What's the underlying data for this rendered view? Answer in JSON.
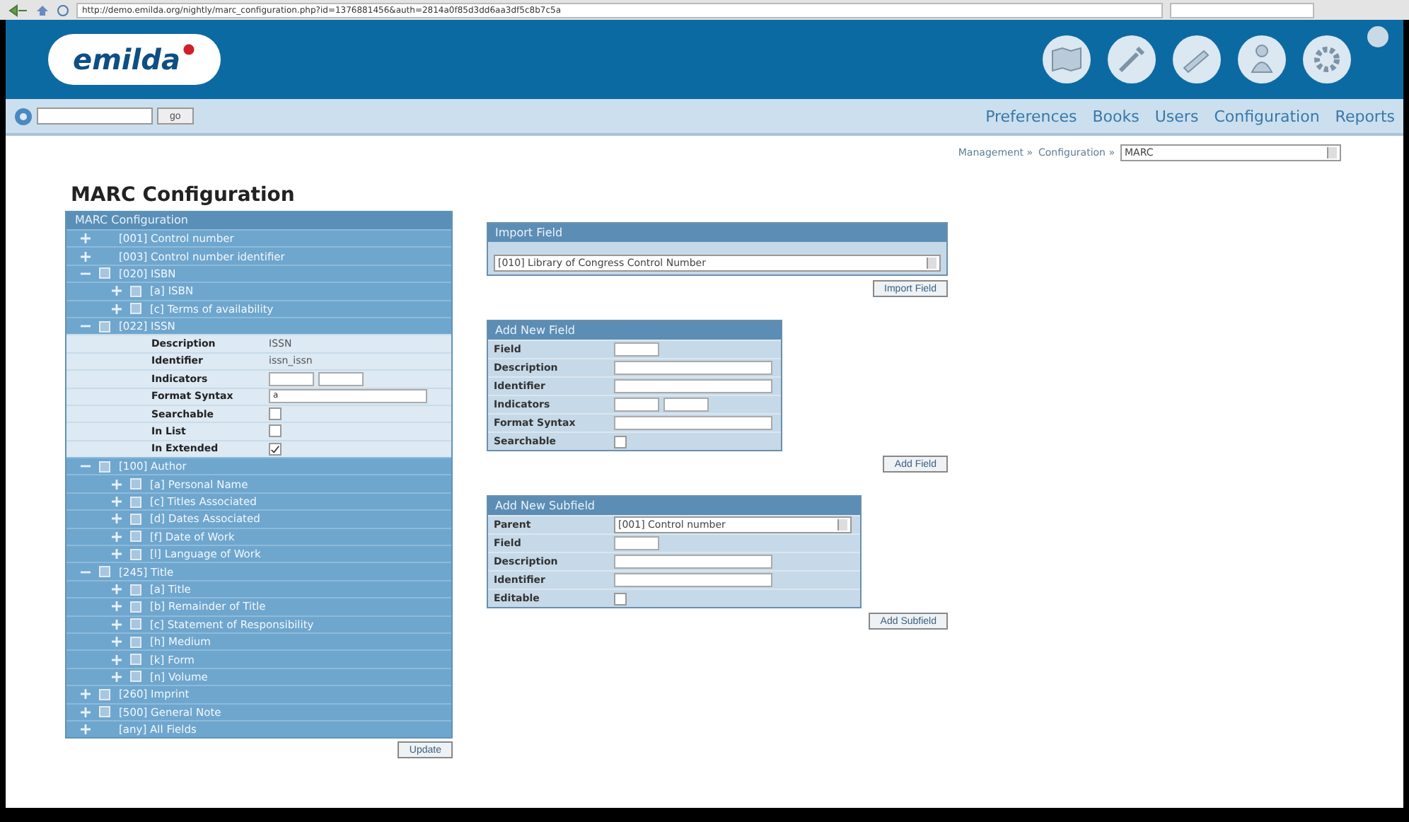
{
  "browser": {
    "url": "http://demo.emilda.org/nightly/marc_configuration.php?id=1376881456&auth=2814a0f85d3dd6aa3df5c8b7c5a"
  },
  "header": {
    "logo": "emilda"
  },
  "navbar": {
    "search_button": "go",
    "links": [
      "Preferences",
      "Books",
      "Users",
      "Configuration",
      "Reports"
    ]
  },
  "breadcrumb": {
    "items": [
      "Management »",
      "Configuration »"
    ],
    "select": "MARC"
  },
  "page_title": "MARC Configuration",
  "tree": {
    "title": "MARC Configuration",
    "button": "Update",
    "nodes": [
      {
        "label": "[001] Control number",
        "kind": "plain",
        "expanded": false
      },
      {
        "label": "[003] Control number identifier",
        "kind": "plain",
        "expanded": false
      },
      {
        "label": "[020] ISBN",
        "kind": "boxed",
        "expanded": true,
        "children": [
          {
            "label": "[a] ISBN",
            "kind": "boxed",
            "expanded": false
          },
          {
            "label": "[c] Terms of availability",
            "kind": "boxed",
            "expanded": false
          }
        ]
      },
      {
        "label": "[022] ISSN",
        "kind": "boxed",
        "expanded": true,
        "details": [
          {
            "label": "Description",
            "kind": "text",
            "value": "ISSN"
          },
          {
            "label": "Identifier",
            "kind": "text",
            "value": "issn_issn"
          },
          {
            "label": "Indicators",
            "kind": "pair"
          },
          {
            "label": "Format Syntax",
            "kind": "input",
            "value": "a"
          },
          {
            "label": "Searchable",
            "kind": "checkbox",
            "checked": false
          },
          {
            "label": "In List",
            "kind": "checkbox",
            "checked": false
          },
          {
            "label": "In Extended",
            "kind": "checkbox",
            "checked": true
          }
        ]
      },
      {
        "label": "[100] Author",
        "kind": "boxed",
        "expanded": true,
        "children": [
          {
            "label": "[a] Personal Name",
            "kind": "boxed",
            "expanded": false
          },
          {
            "label": "[c] Titles Associated",
            "kind": "boxed",
            "expanded": false
          },
          {
            "label": "[d] Dates Associated",
            "kind": "boxed",
            "expanded": false
          },
          {
            "label": "[f] Date of Work",
            "kind": "boxed",
            "expanded": false
          },
          {
            "label": "[l] Language of Work",
            "kind": "boxed",
            "expanded": false
          }
        ]
      },
      {
        "label": "[245] Title",
        "kind": "boxed",
        "expanded": true,
        "children": [
          {
            "label": "[a] Title",
            "kind": "boxed",
            "expanded": false
          },
          {
            "label": "[b] Remainder of Title",
            "kind": "boxed",
            "expanded": false
          },
          {
            "label": "[c] Statement of Responsibility",
            "kind": "boxed",
            "expanded": false
          },
          {
            "label": "[h] Medium",
            "kind": "boxed",
            "expanded": false
          },
          {
            "label": "[k] Form",
            "kind": "boxed",
            "expanded": false
          },
          {
            "label": "[n] Volume",
            "kind": "boxed",
            "expanded": false
          }
        ]
      },
      {
        "label": "[260] Imprint",
        "kind": "boxed",
        "expanded": false
      },
      {
        "label": "[500] General Note",
        "kind": "boxed",
        "expanded": false
      },
      {
        "label": "[any] All Fields",
        "kind": "plain",
        "expanded": false
      }
    ]
  },
  "forms": [
    {
      "title": "Import Field",
      "kind": "import",
      "select": "[010] Library of Congress Control Number",
      "button": "Import Field"
    },
    {
      "title": "Add New Field",
      "kind": "rows",
      "button": "Add Field",
      "rows": [
        {
          "label": "Field",
          "kind": "short"
        },
        {
          "label": "Description",
          "kind": "wide"
        },
        {
          "label": "Identifier",
          "kind": "wide"
        },
        {
          "label": "Indicators",
          "kind": "pair"
        },
        {
          "label": "Format Syntax",
          "kind": "wide"
        },
        {
          "label": "Searchable",
          "kind": "checkbox",
          "checked": false
        }
      ]
    },
    {
      "title": "Add New Subfield",
      "kind": "rows",
      "button": "Add Subfield",
      "rows": [
        {
          "label": "Parent",
          "kind": "select",
          "value": "[001] Control number"
        },
        {
          "label": "Field",
          "kind": "short"
        },
        {
          "label": "Description",
          "kind": "wide"
        },
        {
          "label": "Identifier",
          "kind": "wide"
        },
        {
          "label": "Editable",
          "kind": "checkbox",
          "checked": false
        }
      ]
    }
  ]
}
